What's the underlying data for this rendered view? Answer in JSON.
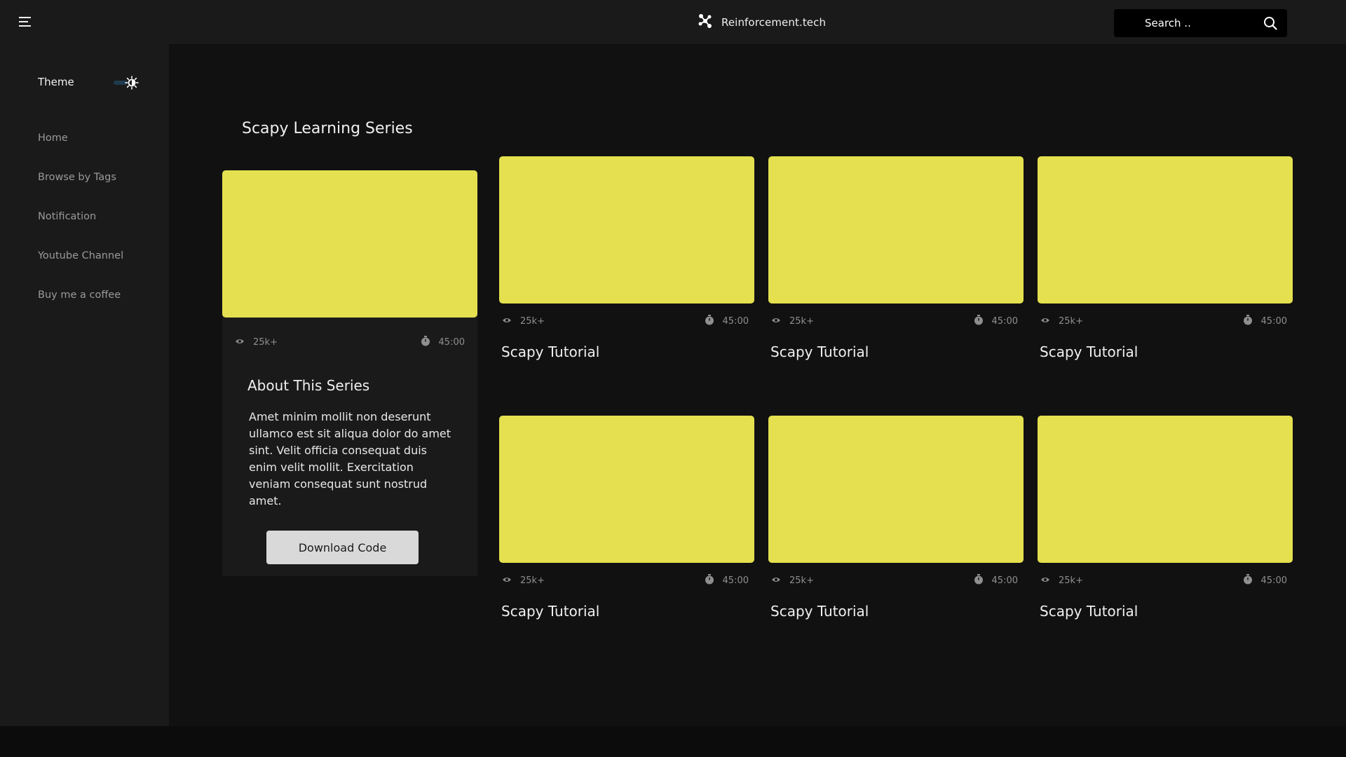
{
  "header": {
    "brand": "Reinforcement.tech",
    "search_placeholder": "Search .."
  },
  "sidebar": {
    "theme_label": "Theme",
    "items": [
      {
        "label": "Home"
      },
      {
        "label": "Browse by Tags"
      },
      {
        "label": "Notification"
      },
      {
        "label": "Youtube Channel"
      },
      {
        "label": "Buy me a coffee"
      }
    ]
  },
  "main": {
    "title": "Scapy Learning Series",
    "about": {
      "views": "25k+",
      "duration": "45:00",
      "heading": "About This Series",
      "description": "Amet minim mollit non deserunt ullamco est sit aliqua dolor do amet sint. Velit officia consequat duis enim velit mollit. Exercitation veniam consequat sunt nostrud amet.",
      "button": "Download Code"
    },
    "videos": [
      {
        "title": "Scapy Tutorial",
        "views": "25k+",
        "duration": "45:00"
      },
      {
        "title": "Scapy Tutorial",
        "views": "25k+",
        "duration": "45:00"
      },
      {
        "title": "Scapy Tutorial",
        "views": "25k+",
        "duration": "45:00"
      },
      {
        "title": "Scapy Tutorial",
        "views": "25k+",
        "duration": "45:00"
      },
      {
        "title": "Scapy Tutorial",
        "views": "25k+",
        "duration": "45:00"
      },
      {
        "title": "Scapy Tutorial",
        "views": "25k+",
        "duration": "45:00"
      }
    ]
  },
  "colors": {
    "background": "#111111",
    "panel": "#1a1a1a",
    "thumbnail": "#e4e04f",
    "button": "#d9d9d9"
  },
  "icons": [
    "menu-icon",
    "logo-icon",
    "search-icon",
    "theme-toggle-icon",
    "eye-icon",
    "timer-icon"
  ]
}
